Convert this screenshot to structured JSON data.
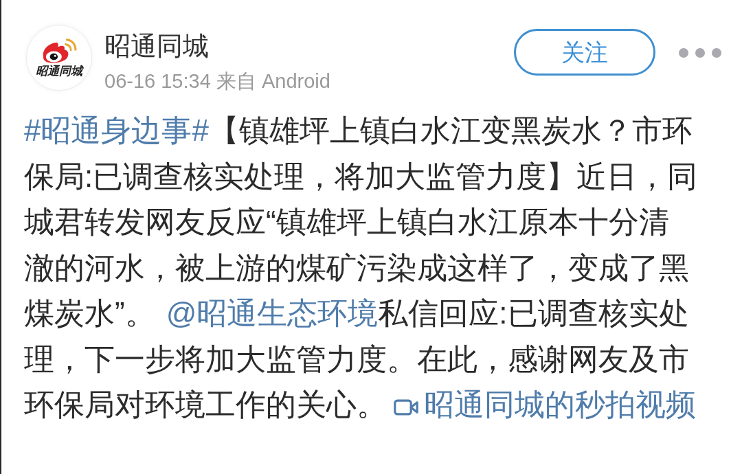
{
  "post_header": {
    "avatar": {
      "caption": "昭通同城"
    },
    "author_name": "昭通同城",
    "meta": "06-16 15:34 来自 Android",
    "follow_button": "关注"
  },
  "post_body": [
    {
      "kind": "hashtag",
      "text": "#昭通身边事#"
    },
    {
      "kind": "text",
      "text": "【镇雄坪上镇白水江变黑炭水？市环保局:已调查核实处理，将加大监管力度】近日，同城君转发网友反应“镇雄坪上镇白水江原本十分清澈的河水，被上游的煤矿污染成这样了，变成了黑煤炭水”。"
    },
    {
      "kind": "mention",
      "text": "@昭通生态环境"
    },
    {
      "kind": "text",
      "text": "私信回应:已调查核实处理，下一步将加大监管力度。在此，感谢网友及市环保局对环境工作的关心。"
    },
    {
      "kind": "video_link",
      "text": "昭通同城的秒拍视频"
    }
  ]
}
